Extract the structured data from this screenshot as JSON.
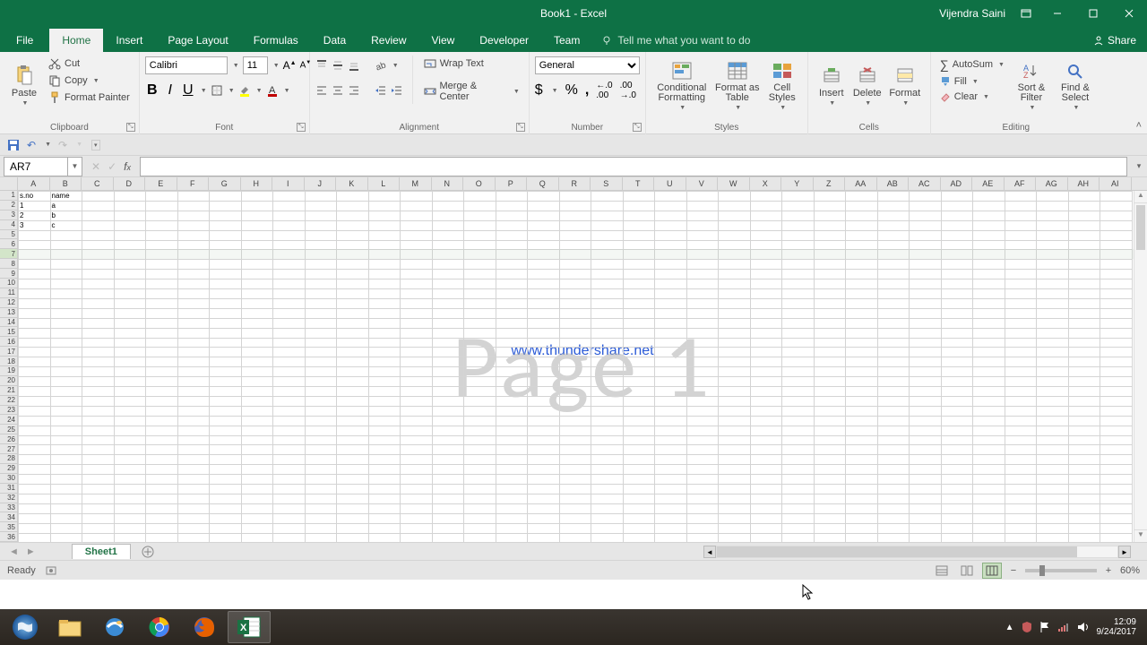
{
  "title": "Book1 - Excel",
  "user": "Vijendra Saini",
  "tabs": {
    "file": "File",
    "home": "Home",
    "insert": "Insert",
    "pagelayout": "Page Layout",
    "formulas": "Formulas",
    "data": "Data",
    "review": "Review",
    "view": "View",
    "developer": "Developer",
    "team": "Team"
  },
  "tellme": "Tell me what you want to do",
  "share": "Share",
  "ribbon": {
    "clipboard": {
      "paste": "Paste",
      "cut": "Cut",
      "copy": "Copy",
      "fmtpainter": "Format Painter",
      "label": "Clipboard"
    },
    "font": {
      "name": "Calibri",
      "size": "11",
      "label": "Font"
    },
    "alignment": {
      "wrap": "Wrap Text",
      "merge": "Merge & Center",
      "label": "Alignment"
    },
    "number": {
      "format": "General",
      "label": "Number"
    },
    "styles": {
      "cond": "Conditional Formatting",
      "fat": "Format as Table",
      "cell": "Cell Styles",
      "label": "Styles"
    },
    "cells": {
      "insert": "Insert",
      "delete": "Delete",
      "format": "Format",
      "label": "Cells"
    },
    "editing": {
      "autosum": "AutoSum",
      "fill": "Fill",
      "clear": "Clear",
      "sort": "Sort & Filter",
      "find": "Find & Select",
      "label": "Editing"
    }
  },
  "namebox": "AR7",
  "columns": [
    "A",
    "B",
    "C",
    "D",
    "E",
    "F",
    "G",
    "H",
    "I",
    "J",
    "K",
    "L",
    "M",
    "N",
    "O",
    "P",
    "Q",
    "R",
    "S",
    "T",
    "U",
    "V",
    "W",
    "X",
    "Y",
    "Z",
    "AA",
    "AB",
    "AC",
    "AD",
    "AE",
    "AF",
    "AG",
    "AH",
    "AI"
  ],
  "row_count": 36,
  "cells": {
    "A1": "s.no",
    "B1": "name",
    "A2": "1",
    "B2": "a",
    "A3": "2",
    "B3": "b",
    "A4": "3",
    "B4": "c"
  },
  "selected_row": 7,
  "watermark_link": "www.thundershare.net",
  "watermark_page": "Page 1",
  "sheet": "Sheet1",
  "status": "Ready",
  "zoom": "60%",
  "clock": {
    "time": "12:09",
    "date": "9/24/2017"
  }
}
